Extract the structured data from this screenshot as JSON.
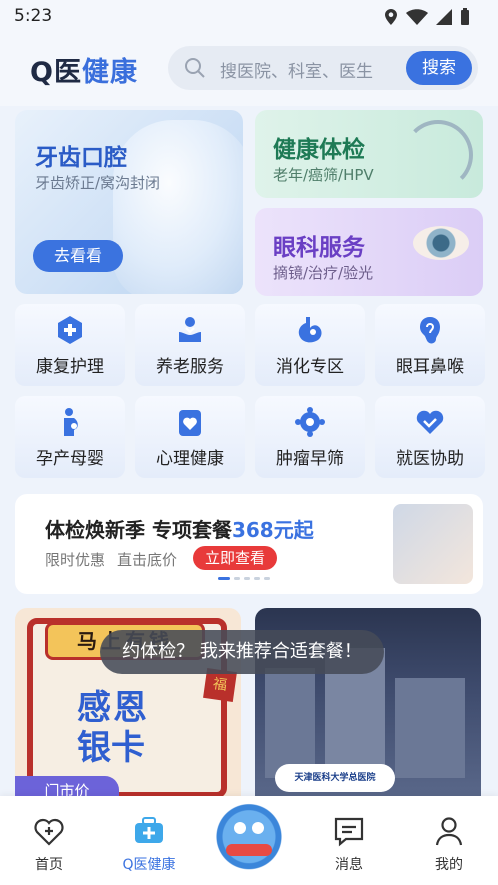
{
  "status_bar": {
    "time": "5:23"
  },
  "header": {
    "logo_q": "Q",
    "logo_yi": "医",
    "logo_health": "健康",
    "search_placeholder": "搜医院、科室、医生",
    "search_button": "搜索"
  },
  "cards": {
    "dental": {
      "title": "牙齿口腔",
      "subtitle": "牙齿矫正/窝沟封闭",
      "button": "去看看"
    },
    "checkup": {
      "title": "健康体检",
      "subtitle": "老年/癌筛/HPV"
    },
    "eye": {
      "title": "眼科服务",
      "subtitle": "摘镜/治疗/验光"
    }
  },
  "grid": [
    {
      "label": "康复护理",
      "icon": "rehab-cross-icon"
    },
    {
      "label": "养老服务",
      "icon": "elderly-care-icon"
    },
    {
      "label": "消化专区",
      "icon": "stomach-icon"
    },
    {
      "label": "眼耳鼻喉",
      "icon": "ear-icon"
    },
    {
      "label": "孕产母婴",
      "icon": "maternity-icon"
    },
    {
      "label": "心理健康",
      "icon": "heart-card-icon"
    },
    {
      "label": "肿瘤早筛",
      "icon": "cell-icon"
    },
    {
      "label": "就医协助",
      "icon": "handshake-icon"
    }
  ],
  "banner": {
    "title_prefix": "体检焕新季 专项套餐",
    "price": "368元起",
    "tag1": "限时优惠",
    "tag2": "直击底价",
    "cta": "立即查看"
  },
  "promos": {
    "left": {
      "sign": "马上有钱",
      "line1": "感恩",
      "line2": "银卡",
      "fu": "福",
      "price_tag": "门市价"
    },
    "right": {
      "hospital_badge": "天津医科大学总医院"
    }
  },
  "tooltip": "约体检？ 我来推荐合适套餐！",
  "tabbar": [
    {
      "label": "首页",
      "icon": "home-heart-icon"
    },
    {
      "label": "Q医健康",
      "icon": "medkit-icon"
    },
    {
      "label": "消息",
      "icon": "message-icon"
    },
    {
      "label": "我的",
      "icon": "user-icon"
    }
  ],
  "colors": {
    "accent": "#3a72e0",
    "cta_red": "#e83a3a",
    "green_card": "#dff3ea",
    "purple_card": "#ece3fb"
  }
}
